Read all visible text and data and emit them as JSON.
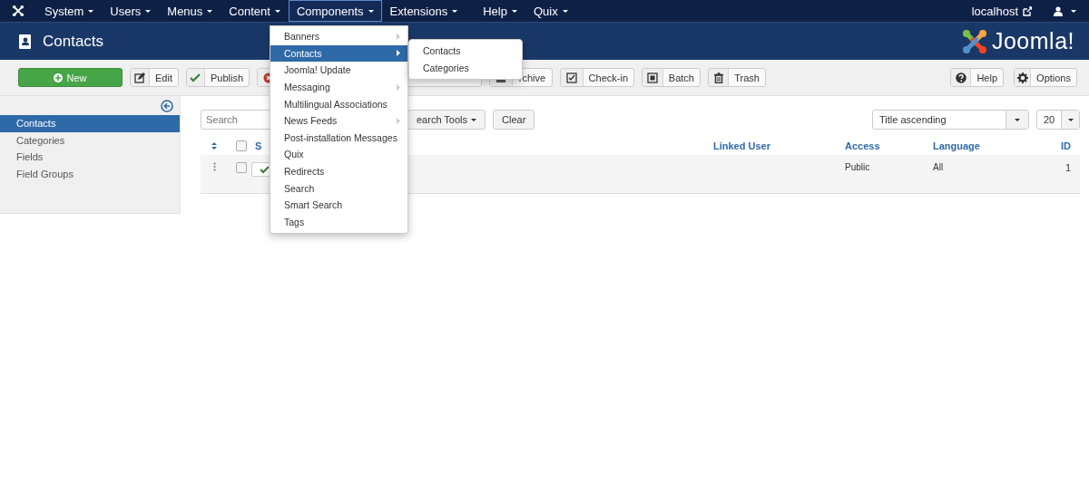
{
  "nav": {
    "items": [
      {
        "label": "System",
        "selected": false
      },
      {
        "label": "Users",
        "selected": false
      },
      {
        "label": "Menus",
        "selected": false
      },
      {
        "label": "Content",
        "selected": false
      },
      {
        "label": "Components",
        "selected": true
      },
      {
        "label": "Extensions",
        "selected": false
      },
      {
        "label": "Help",
        "selected": false
      },
      {
        "label": "Quix",
        "selected": false
      }
    ],
    "site_link": "localhost"
  },
  "header": {
    "title": "Contacts",
    "logo_text": "Joomla!"
  },
  "toolbar": {
    "buttons": [
      {
        "kind": "new",
        "label": "New"
      },
      {
        "kind": "edit",
        "label": "Edit"
      },
      {
        "kind": "publish",
        "label": "Publish"
      },
      {
        "kind": "unpublish"
      },
      {
        "kind": "covered"
      },
      {
        "kind": "archive",
        "label": "rchive"
      },
      {
        "kind": "checkin",
        "label": "Check-in"
      },
      {
        "kind": "batch",
        "label": "Batch"
      },
      {
        "kind": "trash",
        "label": "Trash"
      }
    ],
    "right_buttons": [
      {
        "kind": "help",
        "label": "Help"
      },
      {
        "kind": "options",
        "label": "Options"
      }
    ]
  },
  "sidebar": {
    "items": [
      {
        "label": "Contacts",
        "selected": true
      },
      {
        "label": "Categories",
        "selected": false
      },
      {
        "label": "Fields",
        "selected": false
      },
      {
        "label": "Field Groups",
        "selected": false
      }
    ]
  },
  "filters": {
    "search": {
      "placeholder": "Search"
    },
    "search_tools": "earch Tools",
    "clear": "Clear",
    "ordering": "Title ascending",
    "limit": "20"
  },
  "table": {
    "header_checked": false,
    "columns": [
      "S",
      "Linked User",
      "Access",
      "Language",
      "ID"
    ],
    "rows": [
      {
        "checked": false,
        "published": true,
        "access": "Public",
        "language": "All",
        "id": "1"
      }
    ]
  },
  "menu": {
    "items": [
      {
        "label": "Banners",
        "has_submenu": true,
        "selected": false
      },
      {
        "label": "Contacts",
        "has_submenu": true,
        "selected": true
      },
      {
        "label": "Joomla! Update",
        "has_submenu": false,
        "selected": false
      },
      {
        "label": "Messaging",
        "has_submenu": true,
        "selected": false
      },
      {
        "label": "Multilingual Associations",
        "has_submenu": false,
        "selected": false
      },
      {
        "label": "News Feeds",
        "has_submenu": true,
        "selected": false
      },
      {
        "label": "Post-installation Messages",
        "has_submenu": false,
        "selected": false
      },
      {
        "label": "Quix",
        "has_submenu": false,
        "selected": false
      },
      {
        "label": "Redirects",
        "has_submenu": false,
        "selected": false
      },
      {
        "label": "Search",
        "has_submenu": false,
        "selected": false
      },
      {
        "label": "Smart Search",
        "has_submenu": false,
        "selected": false
      },
      {
        "label": "Tags",
        "has_submenu": false,
        "selected": false
      }
    ],
    "submenu": [
      {
        "label": "Contacts",
        "selected": false
      },
      {
        "label": "Categories",
        "selected": false
      }
    ]
  }
}
